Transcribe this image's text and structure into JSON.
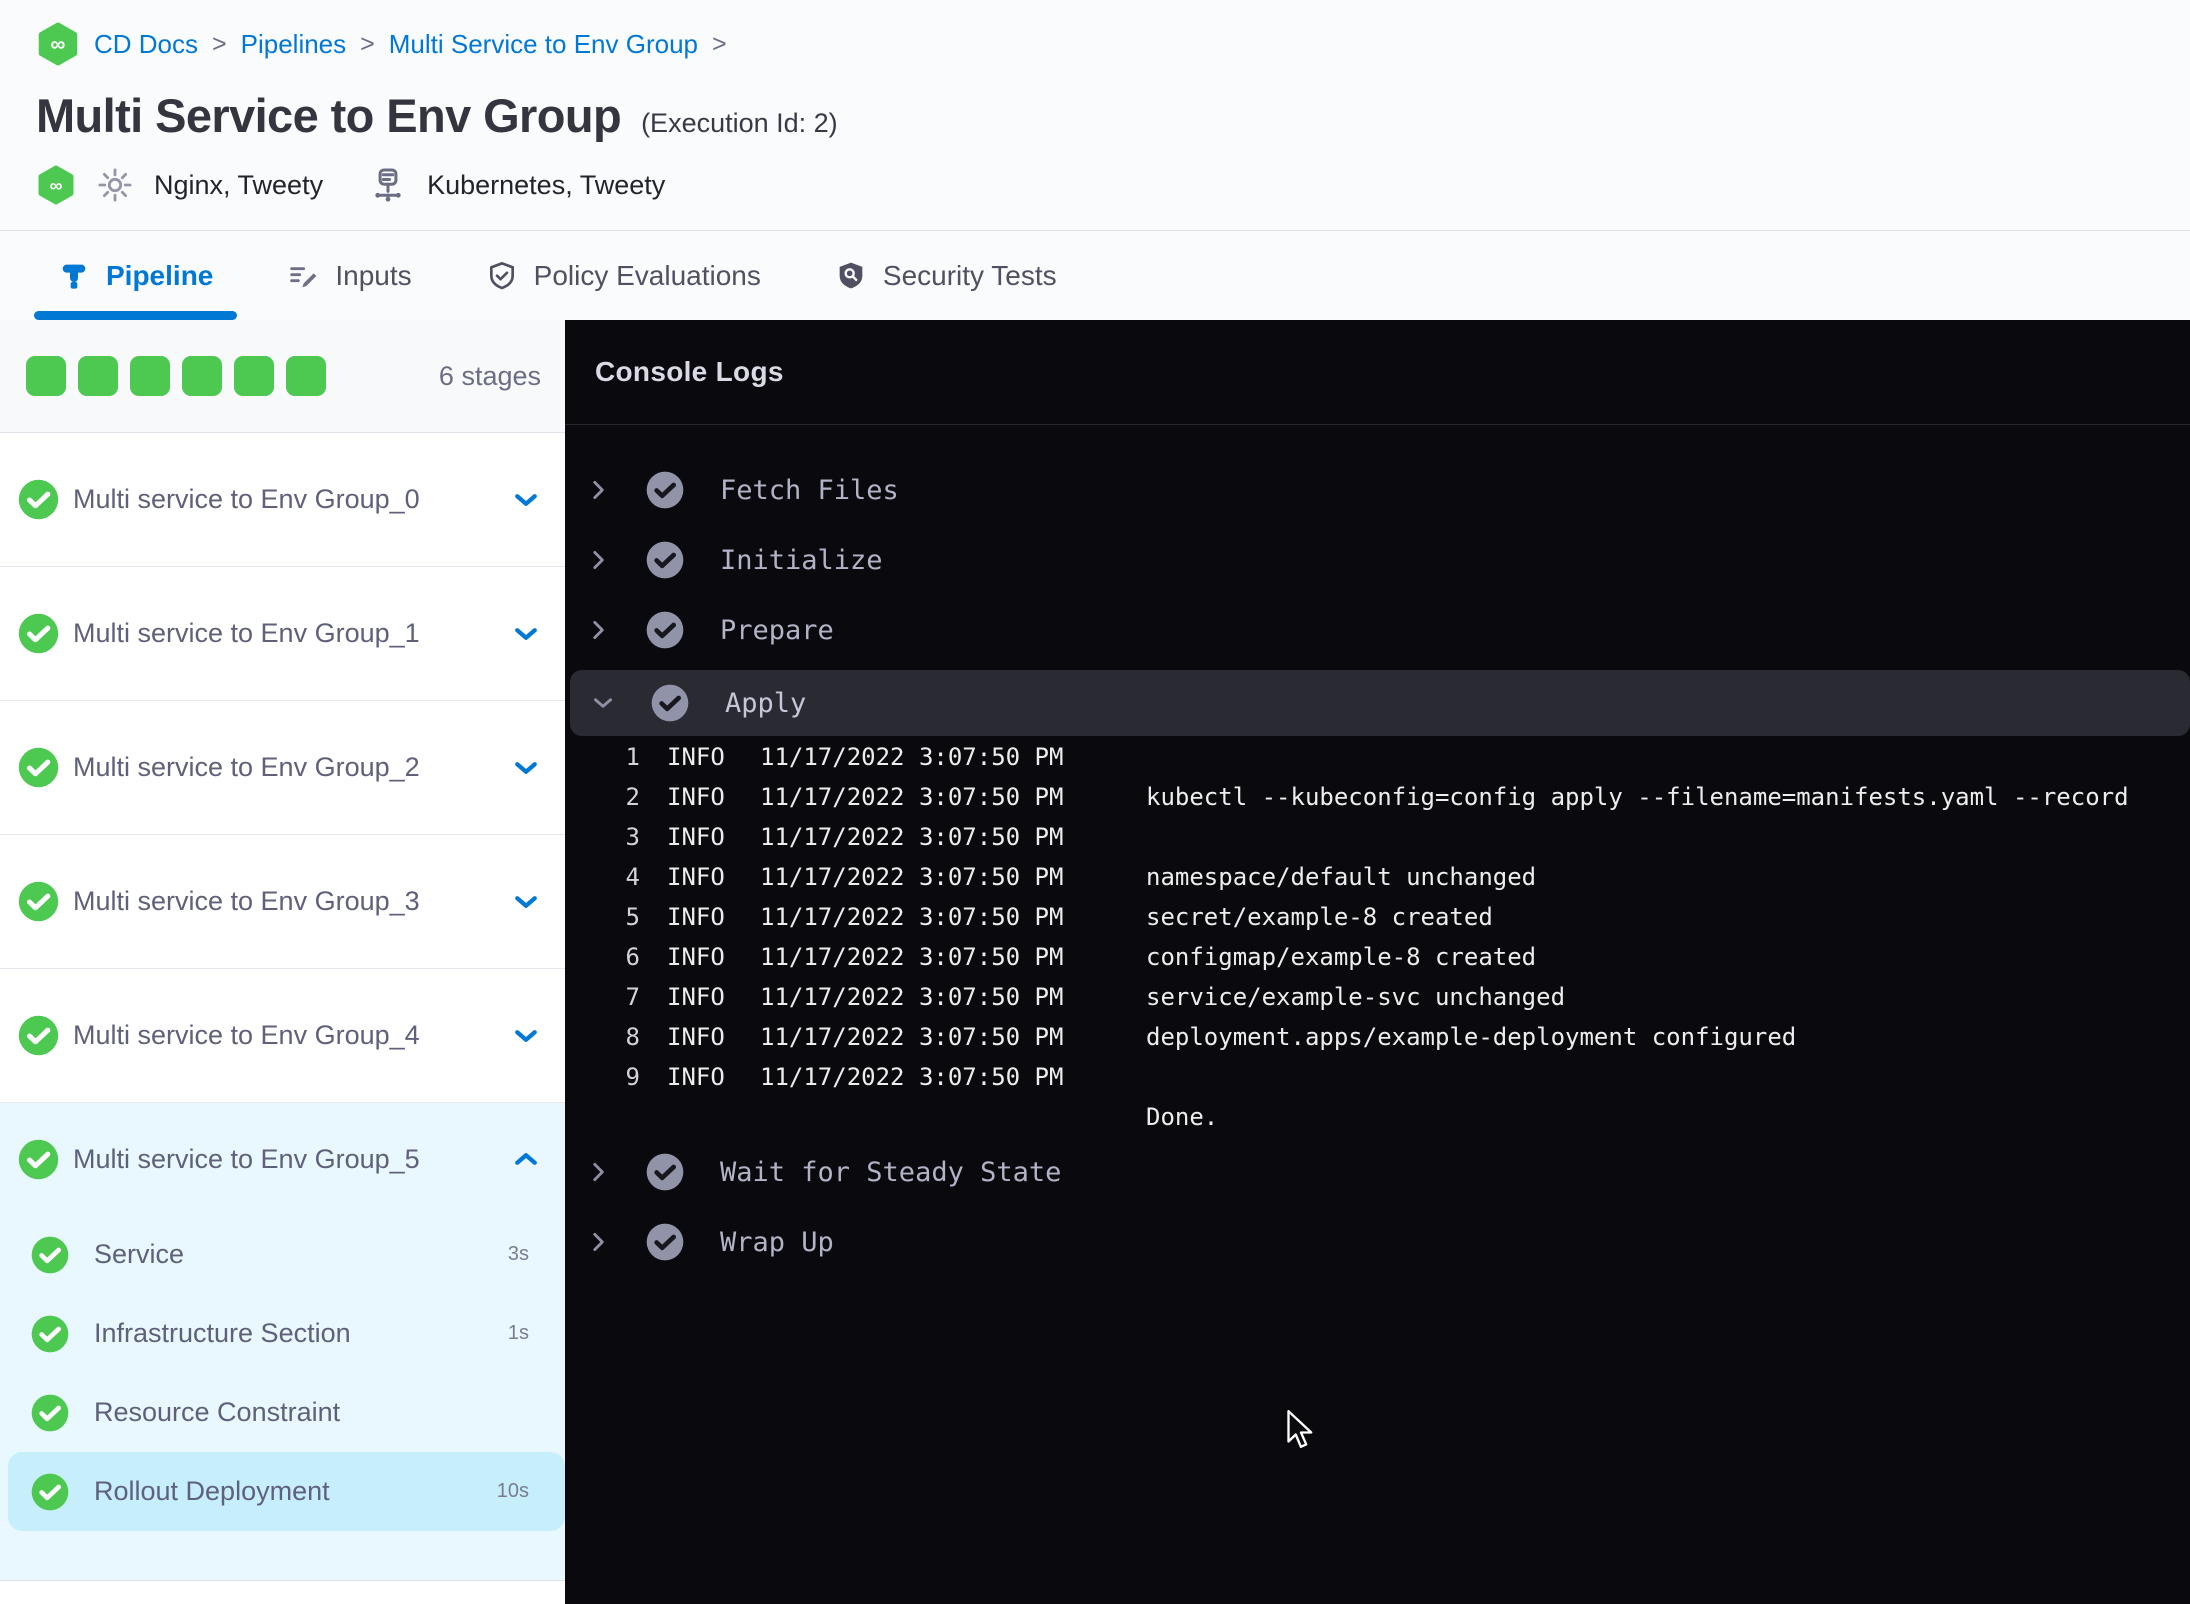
{
  "theme": {
    "accent": "#0278d5",
    "success": "#4dc952",
    "console_bg": "#0a0a0e",
    "console_header_bg": "#2a2a33",
    "expanded_bg": "#e9f8fe",
    "selected_bg": "#c7effb"
  },
  "breadcrumb": {
    "items": [
      {
        "label": "CD Docs"
      },
      {
        "label": "Pipelines"
      },
      {
        "label": "Multi Service to Env Group"
      }
    ]
  },
  "header": {
    "title": "Multi Service to Env Group",
    "execution_id": "(Execution Id: 2)",
    "services": "Nginx, Tweety",
    "infrastructure": "Kubernetes, Tweety"
  },
  "tabs": [
    {
      "label": "Pipeline",
      "icon": "pipeline-icon",
      "active": true
    },
    {
      "label": "Inputs",
      "icon": "inputs-icon",
      "active": false
    },
    {
      "label": "Policy Evaluations",
      "icon": "shield-check-icon",
      "active": false
    },
    {
      "label": "Security Tests",
      "icon": "shield-search-icon",
      "active": false
    }
  ],
  "sidebar": {
    "stages_count": "6 stages",
    "progress_squares": 6,
    "stages": [
      {
        "label": "Multi service to Env Group_0",
        "status": "success",
        "expanded": false
      },
      {
        "label": "Multi service to Env Group_1",
        "status": "success",
        "expanded": false
      },
      {
        "label": "Multi service to Env Group_2",
        "status": "success",
        "expanded": false
      },
      {
        "label": "Multi service to Env Group_3",
        "status": "success",
        "expanded": false
      },
      {
        "label": "Multi service to Env Group_4",
        "status": "success",
        "expanded": false
      },
      {
        "label": "Multi service to Env Group_5",
        "status": "success",
        "expanded": true,
        "steps": [
          {
            "label": "Service",
            "duration": "3s",
            "selected": false
          },
          {
            "label": "Infrastructure Section",
            "duration": "1s",
            "selected": false
          },
          {
            "label": "Resource Constraint",
            "duration": "",
            "selected": false
          },
          {
            "label": "Rollout Deployment",
            "duration": "10s",
            "selected": true
          }
        ]
      }
    ]
  },
  "console": {
    "title": "Console Logs",
    "sections": [
      {
        "label": "Fetch Files",
        "state": "collapsed"
      },
      {
        "label": "Initialize",
        "state": "collapsed"
      },
      {
        "label": "Prepare",
        "state": "collapsed"
      },
      {
        "label": "Apply",
        "state": "expanded",
        "logs": [
          {
            "num": "1",
            "level": "INFO",
            "time": "11/17/2022 3:07:50 PM",
            "message": ""
          },
          {
            "num": "2",
            "level": "INFO",
            "time": "11/17/2022 3:07:50 PM",
            "message": "kubectl --kubeconfig=config apply --filename=manifests.yaml --record"
          },
          {
            "num": "3",
            "level": "INFO",
            "time": "11/17/2022 3:07:50 PM",
            "message": ""
          },
          {
            "num": "4",
            "level": "INFO",
            "time": "11/17/2022 3:07:50 PM",
            "message": "namespace/default unchanged"
          },
          {
            "num": "5",
            "level": "INFO",
            "time": "11/17/2022 3:07:50 PM",
            "message": "secret/example-8 created"
          },
          {
            "num": "6",
            "level": "INFO",
            "time": "11/17/2022 3:07:50 PM",
            "message": "configmap/example-8 created"
          },
          {
            "num": "7",
            "level": "INFO",
            "time": "11/17/2022 3:07:50 PM",
            "message": "service/example-svc unchanged"
          },
          {
            "num": "8",
            "level": "INFO",
            "time": "11/17/2022 3:07:50 PM",
            "message": "deployment.apps/example-deployment configured"
          },
          {
            "num": "9",
            "level": "INFO",
            "time": "11/17/2022 3:07:50 PM",
            "message": ""
          }
        ],
        "footer": "Done."
      },
      {
        "label": "Wait for Steady State",
        "state": "collapsed"
      },
      {
        "label": "Wrap Up",
        "state": "collapsed"
      }
    ]
  }
}
